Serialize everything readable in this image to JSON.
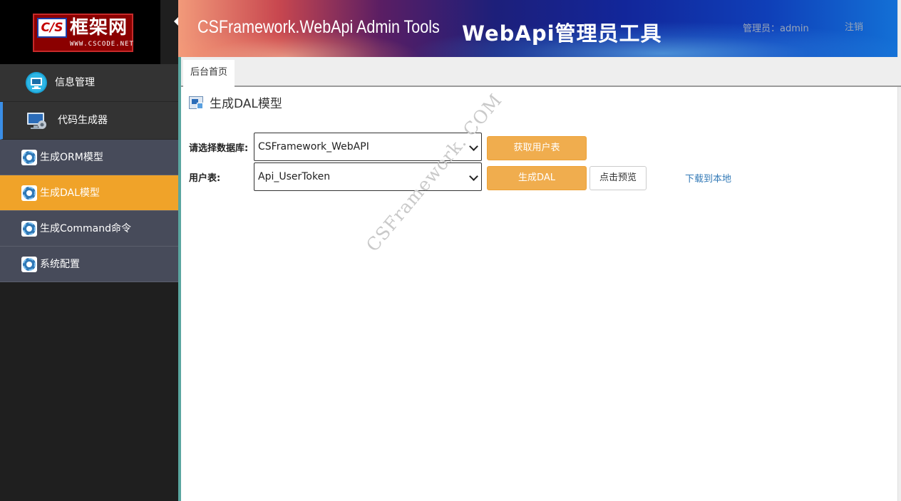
{
  "logo": {
    "badge": "C/S",
    "name": "框架网",
    "url": "WWW.CSCODE.NET"
  },
  "header": {
    "title": "CSFramework.WebApi Admin Tools",
    "subtitle": "WebApi管理员工具",
    "admin_label": "管理员：admin",
    "logout": "注销"
  },
  "sidebar": {
    "groups": [
      {
        "label": "信息管理",
        "icon": "monitor-icon"
      },
      {
        "label": "代码生成器",
        "icon": "computer-gear-icon",
        "active": true
      }
    ],
    "menu": [
      {
        "label": "生成ORM模型",
        "icon": "gear-icon"
      },
      {
        "label": "生成DAL模型",
        "icon": "gear-icon",
        "selected": true
      },
      {
        "label": "生成Command命令",
        "icon": "gear-icon"
      },
      {
        "label": "系统配置",
        "icon": "gear-icon"
      }
    ]
  },
  "tabs": [
    {
      "label": "后台首页",
      "active": true
    }
  ],
  "page": {
    "title": "生成DAL模型",
    "db_label": "请选择数据库:",
    "db_value": "CSFramework_WebAPI",
    "get_tables_button": "获取用户表",
    "table_label": "用户表:",
    "table_value": "Api_UserToken",
    "generate_button": "生成DAL",
    "preview_button": "点击预览",
    "download_link": "下载到本地"
  },
  "watermark": "CSFramework. COM",
  "colors": {
    "sidebar_bg": "#1f1f1f",
    "menu_bg": "#474b5a",
    "menu_selected": "#f0a329",
    "button_orange": "#f0ad4e",
    "link": "#337ab7"
  }
}
